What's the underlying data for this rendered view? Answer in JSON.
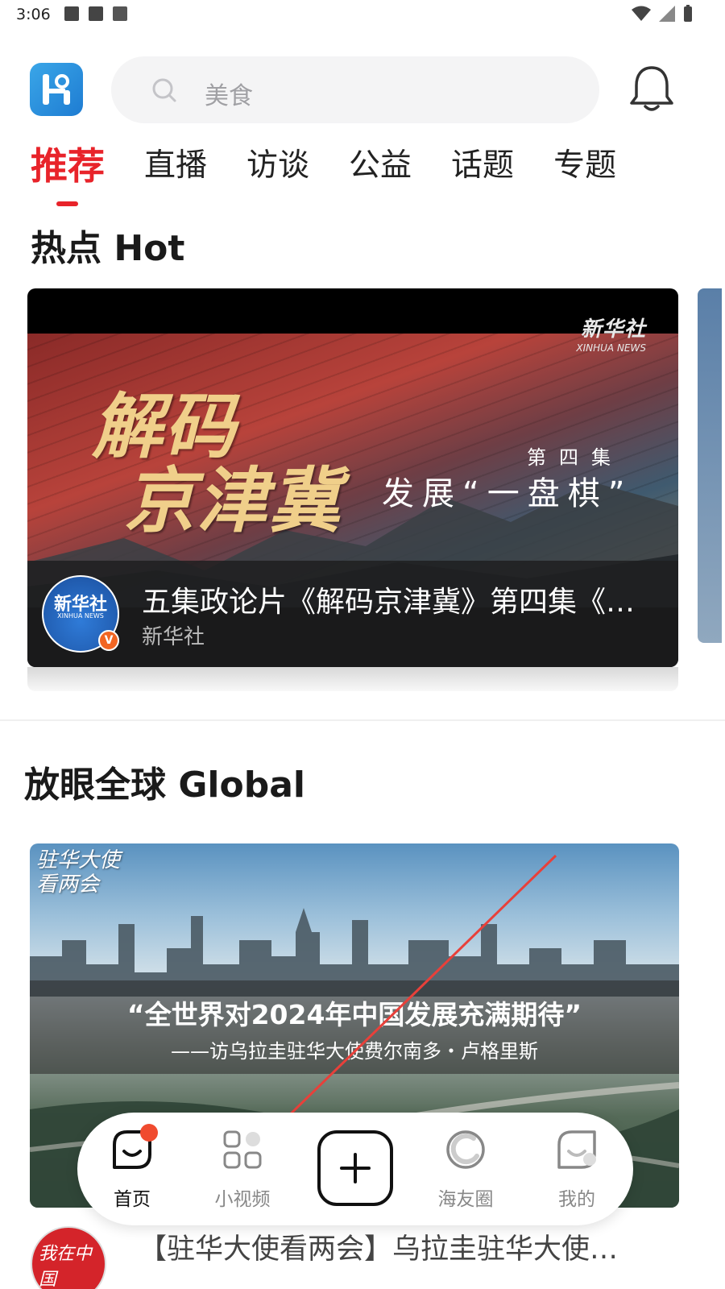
{
  "status_bar": {
    "time": "3:06"
  },
  "header": {
    "search_placeholder": "美食"
  },
  "tabs": [
    {
      "label": "推荐",
      "active": true
    },
    {
      "label": "直播"
    },
    {
      "label": "访谈"
    },
    {
      "label": "公益"
    },
    {
      "label": "话题"
    },
    {
      "label": "专题"
    }
  ],
  "hot": {
    "section_title": "热点 Hot",
    "card": {
      "image_watermark_cn": "新华社",
      "image_watermark_en": "XINHUA NEWS",
      "image_title_line1": "解码",
      "image_title_line2": "京津冀",
      "image_episode": "第四集",
      "image_subtitle": "发展“一盘棋”",
      "avatar_text_cn": "新华社",
      "avatar_text_en": "XINHUA NEWS",
      "verified_badge": "V",
      "headline": "五集政论片《解码京津冀》第四集《…",
      "source": "新华社"
    }
  },
  "global": {
    "section_title": "放眼全球 Global",
    "card": {
      "watermark_line1": "驻华大使",
      "watermark_line2": "看两会",
      "overlay_line1": "“全世界对2024年中国发展充满期待”",
      "overlay_line2": "——访乌拉圭驻华大使费尔南多・卢格里斯"
    },
    "next_item_avatar_text": "我在中国",
    "next_item_headline": "【驻华大使看两会】乌拉圭驻华大使…"
  },
  "bottom_nav": [
    {
      "label": "首页",
      "icon": "home-face-icon",
      "active": true,
      "has_dot": true
    },
    {
      "label": "小视频",
      "icon": "grid-icon"
    },
    {
      "label": "",
      "icon": "plus-icon"
    },
    {
      "label": "海友圈",
      "icon": "circle-refresh-icon"
    },
    {
      "label": "我的",
      "icon": "profile-face-icon"
    }
  ],
  "colors": {
    "accent": "#e8232a",
    "nav_dot": "#f04b2f",
    "verified": "#f26522"
  }
}
